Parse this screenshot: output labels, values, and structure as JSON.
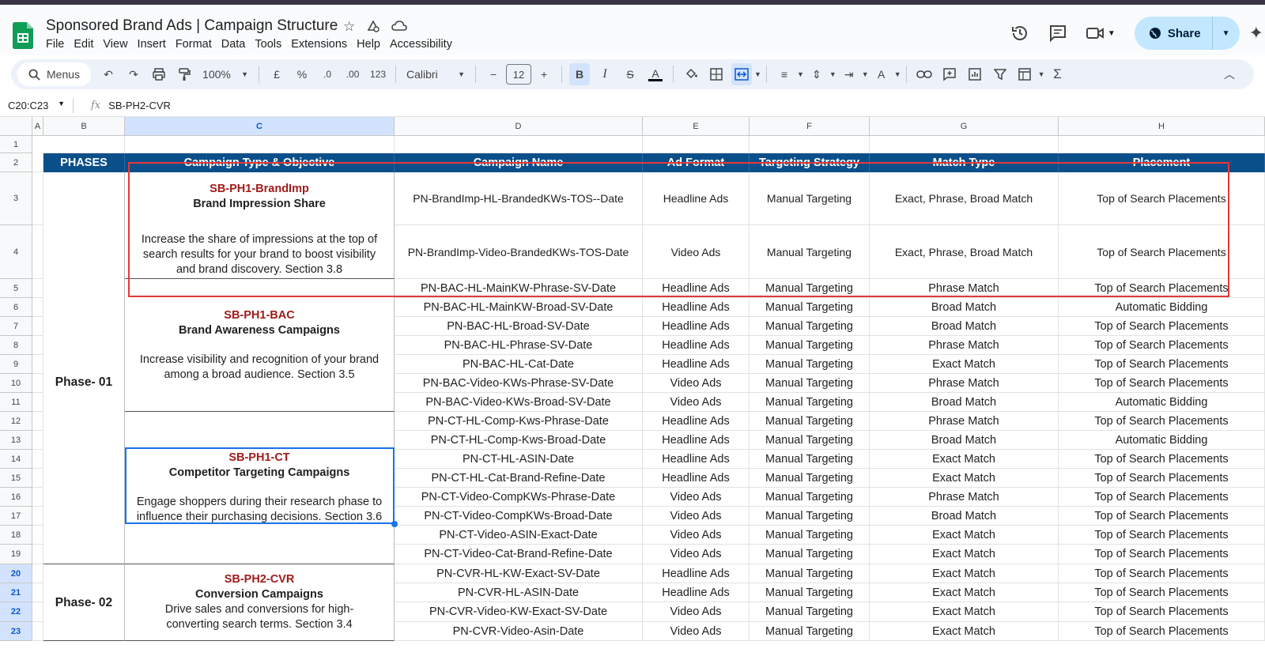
{
  "doc": {
    "title": "Sponsored Brand Ads | Campaign Structure",
    "menu": [
      "File",
      "Edit",
      "View",
      "Insert",
      "Format",
      "Data",
      "Tools",
      "Extensions",
      "Help",
      "Accessibility"
    ],
    "share_label": "Share"
  },
  "toolbar": {
    "menus_label": "Menus",
    "zoom": "100%",
    "currency": "£",
    "percent": "%",
    "dec_decrease": ".0",
    "dec_increase": ".00",
    "num_format": "123",
    "font": "Calibri",
    "font_size": "12"
  },
  "formula_bar": {
    "range": "C20:C23",
    "fx": "fx",
    "value": "SB-PH2-CVR"
  },
  "columns": [
    "A",
    "B",
    "C",
    "D",
    "E",
    "F",
    "G",
    "H"
  ],
  "rows": [
    "1",
    "2",
    "3",
    "4",
    "5",
    "6",
    "7",
    "8",
    "9",
    "10",
    "11",
    "12",
    "13",
    "14",
    "15",
    "16",
    "17",
    "18",
    "19",
    "20",
    "21",
    "22",
    "23"
  ],
  "headers": [
    "PHASES",
    "Campaign Type & Objective",
    "Campaign Name",
    "Ad Format",
    "Targeting Strategy",
    "Match Type",
    "Placement"
  ],
  "groups": [
    {
      "code": "SB-PH1-BrandImp",
      "title": "Brand Impression Share",
      "desc": "Increase the share of impressions at the top of search results for your brand to boost visibility and brand discovery. Section 3.8"
    },
    {
      "code": "SB-PH1-BAC",
      "title": "Brand Awareness Campaigns",
      "desc": "Increase visibility and recognition of your brand among a broad audience. Section 3.5"
    },
    {
      "code": "SB-PH1-CT",
      "title": "Competitor Targeting Campaigns",
      "desc": "Engage shoppers during their research phase to influence their purchasing decisions. Section 3.6"
    },
    {
      "code": "SB-PH2-CVR",
      "title": "Conversion Campaigns",
      "desc": "Drive sales and conversions for high-converting search terms. Section 3.4"
    }
  ],
  "phases": [
    "Phase- 01",
    "Phase- 02"
  ],
  "table_rows": [
    [
      "PN-BrandImp-HL-BrandedKWs-TOS--Date",
      "Headline Ads",
      "Manual Targeting",
      "Exact, Phrase, Broad Match",
      "Top of Search Placements"
    ],
    [
      "PN-BrandImp-Video-BrandedKWs-TOS-Date",
      "Video Ads",
      "Manual Targeting",
      "Exact, Phrase, Broad Match",
      "Top of Search Placements"
    ],
    [
      "PN-BAC-HL-MainKW-Phrase-SV-Date",
      "Headline Ads",
      "Manual Targeting",
      "Phrase Match",
      "Top of Search Placements"
    ],
    [
      "PN-BAC-HL-MainKW-Broad-SV-Date",
      "Headline Ads",
      "Manual Targeting",
      "Broad Match",
      "Automatic Bidding"
    ],
    [
      "PN-BAC-HL-Broad-SV-Date",
      "Headline Ads",
      "Manual Targeting",
      "Broad Match",
      "Top of Search Placements"
    ],
    [
      "PN-BAC-HL-Phrase-SV-Date",
      "Headline Ads",
      "Manual Targeting",
      "Phrase Match",
      "Top of Search Placements"
    ],
    [
      "PN-BAC-HL-Cat-Date",
      "Headline Ads",
      "Manual Targeting",
      "Exact Match",
      "Top of Search Placements"
    ],
    [
      "PN-BAC-Video-KWs-Phrase-SV-Date",
      "Video Ads",
      "Manual Targeting",
      "Phrase Match",
      "Top of Search Placements"
    ],
    [
      "PN-BAC-Video-KWs-Broad-SV-Date",
      "Video Ads",
      "Manual Targeting",
      "Broad Match",
      "Automatic Bidding"
    ],
    [
      "PN-CT-HL-Comp-Kws-Phrase-Date",
      "Headline Ads",
      "Manual Targeting",
      "Phrase Match",
      "Top of Search Placements"
    ],
    [
      "PN-CT-HL-Comp-Kws-Broad-Date",
      "Headline Ads",
      "Manual Targeting",
      "Broad Match",
      "Automatic Bidding"
    ],
    [
      "PN-CT-HL-ASIN-Date",
      "Headline Ads",
      "Manual Targeting",
      "Exact Match",
      "Top of Search Placements"
    ],
    [
      "PN-CT-HL-Cat-Brand-Refine-Date",
      "Headline Ads",
      "Manual Targeting",
      "Exact Match",
      "Top of Search Placements"
    ],
    [
      "PN-CT-Video-CompKWs-Phrase-Date",
      "Video Ads",
      "Manual Targeting",
      "Phrase Match",
      "Top of Search Placements"
    ],
    [
      "PN-CT-Video-CompKWs-Broad-Date",
      "Video Ads",
      "Manual Targeting",
      "Broad Match",
      "Top of Search Placements"
    ],
    [
      "PN-CT-Video-ASIN-Exact-Date",
      "Video Ads",
      "Manual Targeting",
      "Exact Match",
      "Top of Search Placements"
    ],
    [
      "PN-CT-Video-Cat-Brand-Refine-Date",
      "Video Ads",
      "Manual Targeting",
      "Exact Match",
      "Top of Search Placements"
    ],
    [
      "PN-CVR-HL-KW-Exact-SV-Date",
      "Headline Ads",
      "Manual Targeting",
      "Exact Match",
      "Top of Search Placements"
    ],
    [
      "PN-CVR-HL-ASIN-Date",
      "Headline Ads",
      "Manual Targeting",
      "Exact Match",
      "Top of Search Placements"
    ],
    [
      "PN-CVR-Video-KW-Exact-SV-Date",
      "Video Ads",
      "Manual Targeting",
      "Exact Match",
      "Top of Search Placements"
    ],
    [
      "PN-CVR-Video-Asin-Date",
      "Video Ads",
      "Manual Targeting",
      "Exact Match",
      "Top of Search Placements"
    ]
  ],
  "colors": {
    "header_bg": "#0b4f8a",
    "code_red": "#a01c1c",
    "highlight_box": "#e53935",
    "selection": "#1a73e8"
  }
}
